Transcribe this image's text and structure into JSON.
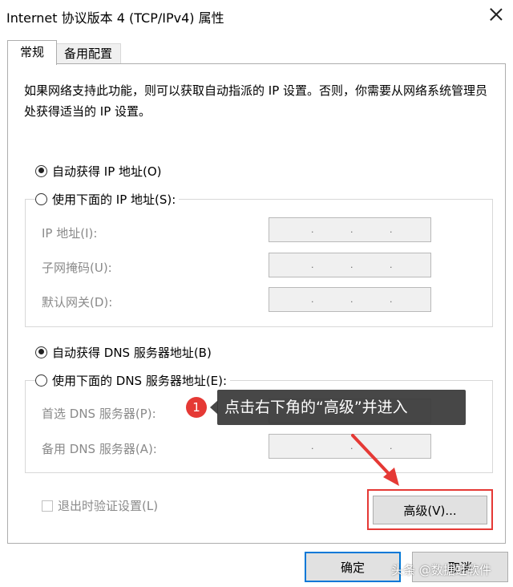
{
  "window": {
    "title": "Internet 协议版本 4 (TCP/IPv4) 属性"
  },
  "tabs": {
    "general": "常规",
    "alternate": "备用配置"
  },
  "description": "如果网络支持此功能，则可以获取自动指派的 IP 设置。否则，你需要从网络系统管理员处获得适当的 IP 设置。",
  "ip": {
    "auto_label": "自动获得 IP 地址(O)",
    "manual_label": "使用下面的 IP 地址(S):",
    "fields": [
      {
        "label": "IP 地址(I):"
      },
      {
        "label": "子网掩码(U):"
      },
      {
        "label": "默认网关(D):"
      }
    ]
  },
  "dns": {
    "auto_label": "自动获得 DNS 服务器地址(B)",
    "manual_label": "使用下面的 DNS 服务器地址(E):",
    "fields": [
      {
        "label": "首选 DNS 服务器(P):"
      },
      {
        "label": "备用 DNS 服务器(A):"
      }
    ]
  },
  "validate_label": "退出时验证设置(L)",
  "buttons": {
    "advanced": "高级(V)...",
    "ok": "确定",
    "cancel": "取消"
  },
  "annotation": {
    "step": "1",
    "text": "点击右下角的“高级”并进入"
  },
  "watermark": "头条 @数据蛙软件",
  "colors": {
    "highlight": "#e53935",
    "ok_border": "#0078d7"
  }
}
